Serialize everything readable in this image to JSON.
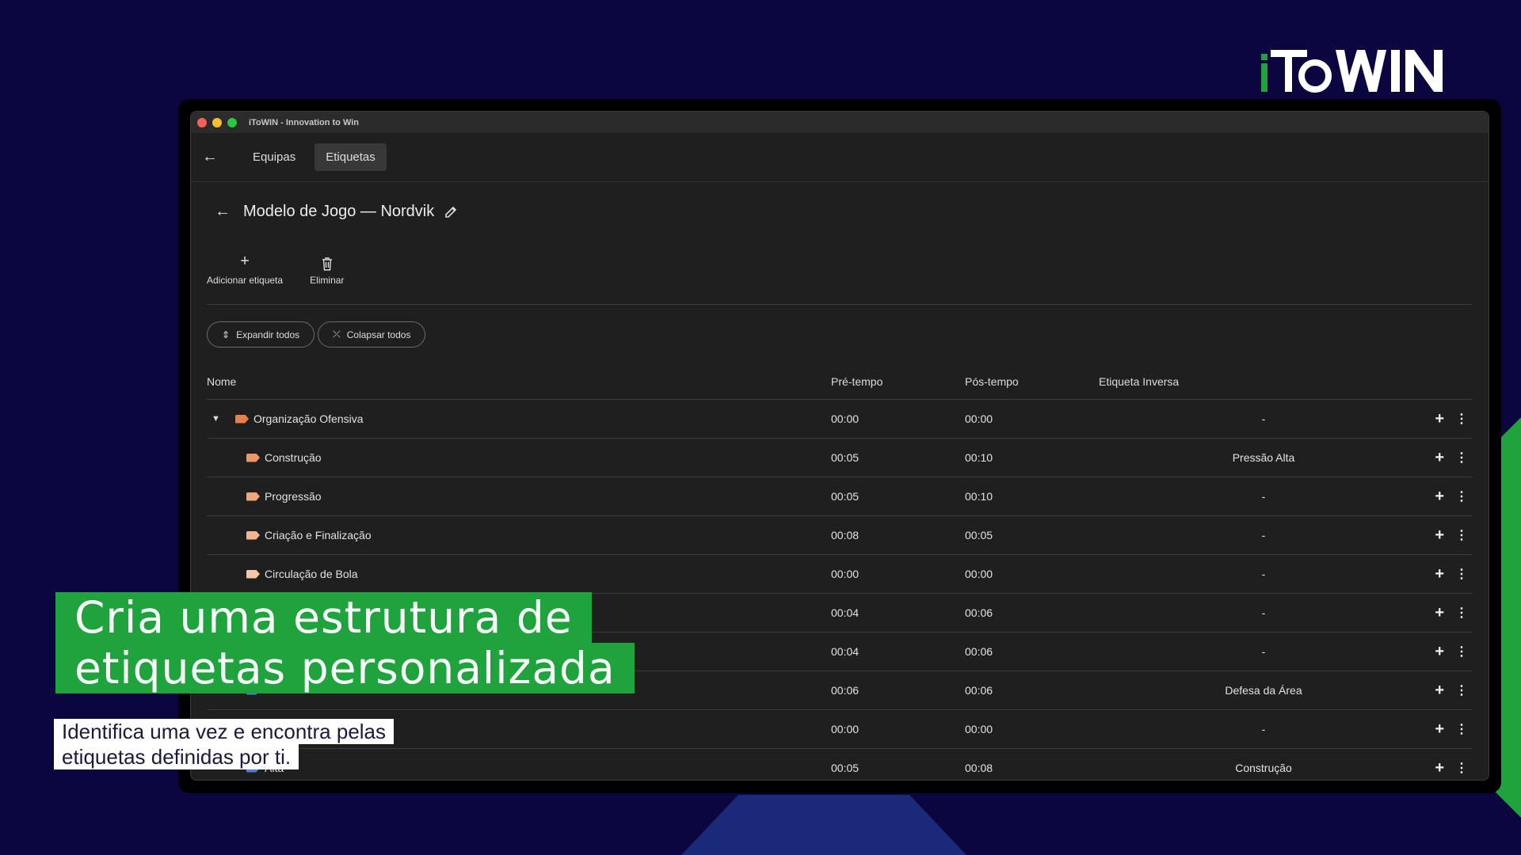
{
  "brand": {
    "logo_text": "iToWIN",
    "accent": "#1fa33d",
    "background": "#0b0640"
  },
  "window": {
    "title": "iToWIN - Innovation to Win"
  },
  "nav": {
    "back_icon": "arrow-left-icon",
    "tabs": [
      {
        "label": "Equipas",
        "active": false
      },
      {
        "label": "Etiquetas",
        "active": true
      }
    ]
  },
  "page": {
    "title": "Modelo de Jogo — Nordvik",
    "edit_icon": "pencil-icon"
  },
  "toolbar": {
    "add_label": "Adicionar etiqueta",
    "delete_label": "Eliminar"
  },
  "buttons": {
    "expand_all": "Expandir todos",
    "collapse_all": "Colapsar todos"
  },
  "table": {
    "headers": {
      "name": "Nome",
      "pre": "Pré-tempo",
      "pos": "Pós-tempo",
      "inverse": "Etiqueta Inversa"
    },
    "rows": [
      {
        "name": "Organização Ofensiva",
        "pre": "00:00",
        "pos": "00:00",
        "inverse": "-",
        "color": "#e8804a",
        "parent": true
      },
      {
        "name": "Construção",
        "pre": "00:05",
        "pos": "00:10",
        "inverse": "Pressão Alta",
        "color": "#f0956a",
        "parent": false
      },
      {
        "name": "Progressão",
        "pre": "00:05",
        "pos": "00:10",
        "inverse": "-",
        "color": "#f0a57d",
        "parent": false
      },
      {
        "name": "Criação e Finalização",
        "pre": "00:08",
        "pos": "00:05",
        "inverse": "-",
        "color": "#f3b58f",
        "parent": false
      },
      {
        "name": "Circulação de Bola",
        "pre": "00:00",
        "pos": "00:00",
        "inverse": "-",
        "color": "#f5c6a8",
        "parent": false
      },
      {
        "name": "",
        "pre": "00:04",
        "pos": "00:06",
        "inverse": "-",
        "color": "#4a7fe0",
        "parent": false
      },
      {
        "name": "",
        "pre": "00:04",
        "pos": "00:06",
        "inverse": "-",
        "color": "#4a7fe0",
        "parent": false
      },
      {
        "name": "",
        "pre": "00:06",
        "pos": "00:06",
        "inverse": "Defesa da Área",
        "color": "#4a7fe0",
        "parent": false
      },
      {
        "name": "",
        "pre": "00:00",
        "pos": "00:00",
        "inverse": "-",
        "color": "#4a7fe0",
        "parent": false
      },
      {
        "name": "Alta",
        "pre": "00:05",
        "pos": "00:08",
        "inverse": "Construção",
        "color": "#4a7fe0",
        "parent": false
      }
    ]
  },
  "overlay": {
    "headline_line1": "Cria uma estrutura de",
    "headline_line2": "etiquetas personalizada",
    "subline1": "Identifica uma vez e encontra pelas",
    "subline2": "etiquetas definidas por ti."
  }
}
